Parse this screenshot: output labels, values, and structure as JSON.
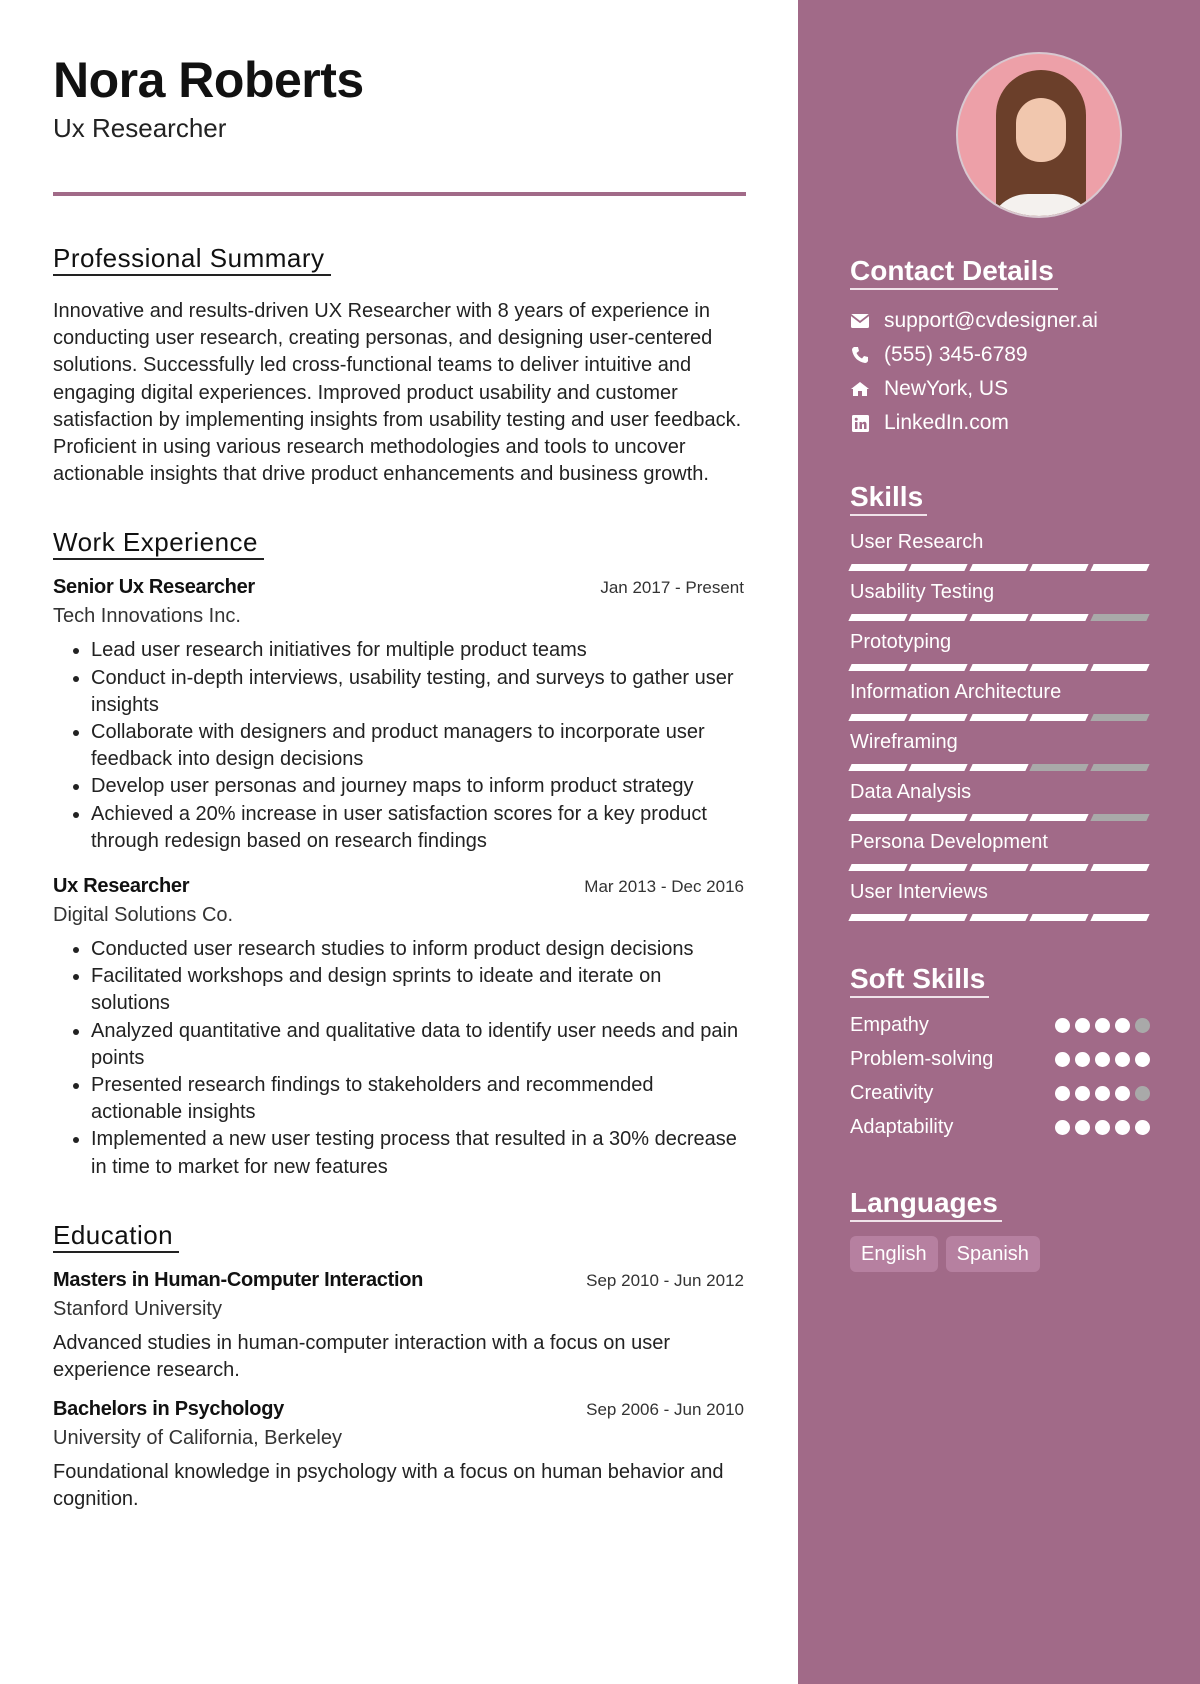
{
  "header": {
    "name": "Nora Roberts",
    "title": "Ux Researcher"
  },
  "summary": {
    "heading": "Professional Summary",
    "text": "Innovative and results-driven UX Researcher with 8 years of experience in conducting user research, creating personas, and designing user-centered solutions. Successfully led cross-functional teams to deliver intuitive and engaging digital experiences. Improved product usability and customer satisfaction by implementing insights from usability testing and user feedback. Proficient in using various research methodologies and tools to uncover actionable insights that drive product enhancements and business growth."
  },
  "experience": {
    "heading": "Work Experience",
    "jobs": [
      {
        "title": "Senior Ux Researcher",
        "dates": "Jan 2017 - Present",
        "company": "Tech Innovations Inc.",
        "bullets": [
          "Lead user research initiatives for multiple product teams",
          "Conduct in-depth interviews, usability testing, and surveys to gather user insights",
          "Collaborate with designers and product managers to incorporate user feedback into design decisions",
          "Develop user personas and journey maps to inform product strategy",
          "Achieved a 20% increase in user satisfaction scores for a key product through redesign based on research findings"
        ]
      },
      {
        "title": "Ux Researcher",
        "dates": "Mar 2013 - Dec 2016",
        "company": "Digital Solutions Co.",
        "bullets": [
          "Conducted user research studies to inform product design decisions",
          "Facilitated workshops and design sprints to ideate and iterate on solutions",
          "Analyzed quantitative and qualitative data to identify user needs and pain points",
          "Presented research findings to stakeholders and recommended actionable insights",
          "Implemented a new user testing process that resulted in a 30% decrease in time to market for new features"
        ]
      }
    ]
  },
  "education": {
    "heading": "Education",
    "items": [
      {
        "degree": "Masters in Human-Computer Interaction",
        "dates": "Sep 2010 - Jun 2012",
        "school": "Stanford University",
        "description": "Advanced studies in human-computer interaction with a focus on user experience research."
      },
      {
        "degree": "Bachelors in Psychology",
        "dates": "Sep 2006 - Jun 2010",
        "school": "University of California, Berkeley",
        "description": "Foundational knowledge in psychology with a focus on human behavior and cognition."
      }
    ]
  },
  "sidebar": {
    "photo_alt": "Profile photo",
    "contact": {
      "heading": "Contact Details",
      "items": [
        {
          "icon": "envelope-icon",
          "text": "support@cvdesigner.ai"
        },
        {
          "icon": "phone-icon",
          "text": "(555) 345-6789"
        },
        {
          "icon": "home-icon",
          "text": "NewYork, US"
        },
        {
          "icon": "linkedin-icon",
          "text": "LinkedIn.com"
        }
      ]
    },
    "skills": {
      "heading": "Skills",
      "max": 5,
      "items": [
        {
          "name": "User Research",
          "level": 5
        },
        {
          "name": "Usability Testing",
          "level": 4
        },
        {
          "name": "Prototyping",
          "level": 5
        },
        {
          "name": "Information Architecture",
          "level": 4
        },
        {
          "name": "Wireframing",
          "level": 3
        },
        {
          "name": "Data Analysis",
          "level": 4
        },
        {
          "name": "Persona Development",
          "level": 5
        },
        {
          "name": "User Interviews",
          "level": 5
        }
      ]
    },
    "soft_skills": {
      "heading": "Soft Skills",
      "max": 5,
      "items": [
        {
          "name": "Empathy",
          "level": 4
        },
        {
          "name": "Problem-solving",
          "level": 5
        },
        {
          "name": "Creativity",
          "level": 4
        },
        {
          "name": "Adaptability",
          "level": 5
        }
      ]
    },
    "languages": {
      "heading": "Languages",
      "items": [
        "English",
        "Spanish"
      ]
    }
  },
  "colors": {
    "accent": "#a16a88",
    "tag_bg": "#b680a0",
    "inactive": "#a9a9a9"
  }
}
